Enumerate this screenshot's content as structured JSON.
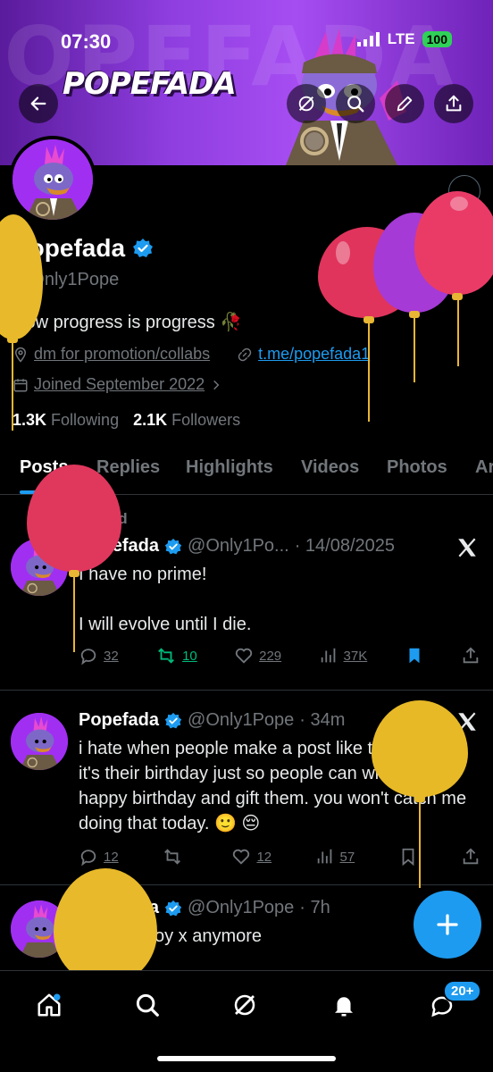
{
  "status": {
    "time": "07:30",
    "network": "LTE",
    "battery": "100"
  },
  "banner": {
    "logo_text": "POPEFADA"
  },
  "profile": {
    "name": "Popefada",
    "handle": "@Only1Pope",
    "bio": "slow progress is progress",
    "location": "dm for promotion/collabs",
    "website": "t.me/popefada1",
    "joined": "Joined September 2022",
    "following_count": "1.3K",
    "following_label": "Following",
    "followers_count": "2.1K",
    "followers_label": "Followers"
  },
  "tabs": [
    "Posts",
    "Replies",
    "Highlights",
    "Videos",
    "Photos",
    "Ar"
  ],
  "pinned_label": "Pinned",
  "posts": [
    {
      "name": "Popefada",
      "handle": "@Only1Po...",
      "time": "· 14/08/2025",
      "line1": "I have no prime!",
      "line2": "I will evolve until I die.",
      "replies": "32",
      "reposts": "10",
      "likes": "229",
      "views": "37K"
    },
    {
      "name": "Popefada",
      "handle": "@Only1Pope",
      "time": "· 34m",
      "text": "i hate when people make a post like this implying it's their birthday just so people can wish them a happy birthday and gift them. you won't catch me doing that today. 🙂 😔",
      "replies": "12",
      "reposts": "",
      "likes": "12",
      "views": "57"
    },
    {
      "name": "Popefada",
      "handle": "@Only1Pope",
      "time": "· 7h",
      "text": "i don't enjoy x anymore"
    }
  ],
  "nav": {
    "badge": "20+"
  },
  "colors": {
    "accent": "#1d9bf0",
    "repost_green": "#00ba7c",
    "banner_purple": "#8f3ee0"
  }
}
